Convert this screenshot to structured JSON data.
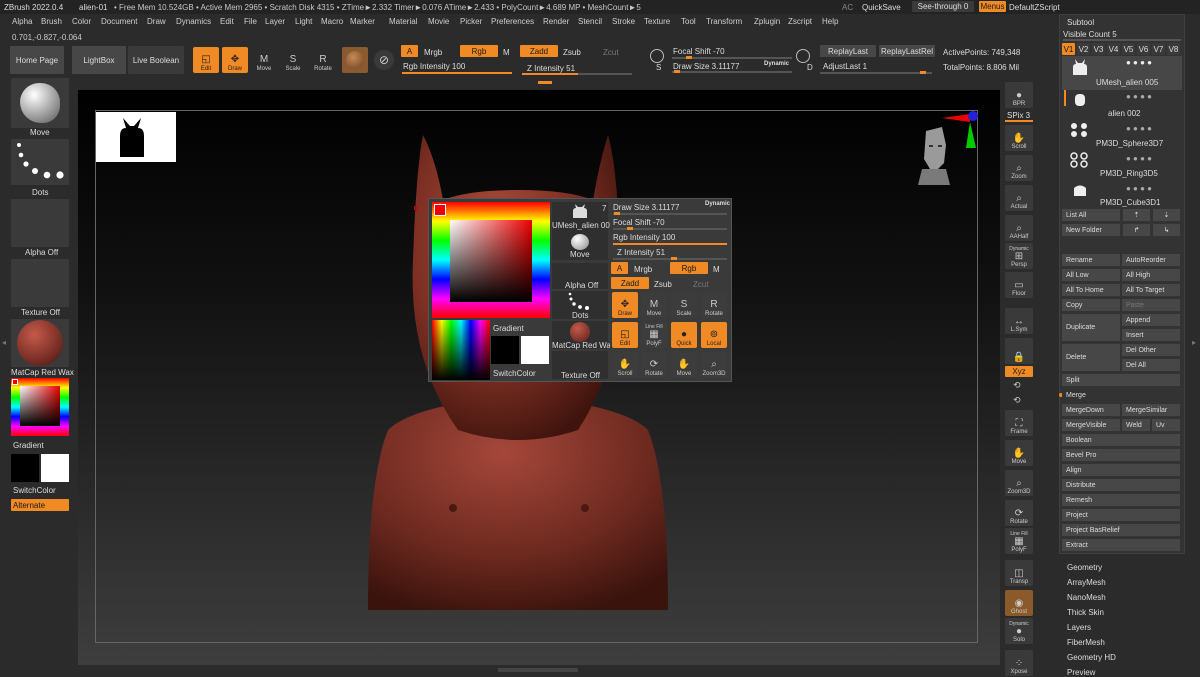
{
  "titlebar": {
    "app": "ZBrush 2022.0.4",
    "doc": "alien-01",
    "stats": "• Free Mem 10.524GB • Active Mem 2965 • Scratch Disk 4315 • ZTime►2.332 Timer►0.076 ATime►2.433 • PolyCount►4.689 MP • MeshCount►5",
    "ac": "AC",
    "quicksave": "QuickSave",
    "seethrough": "See-through  0",
    "menus": "Menus",
    "script": "DefaultZScript"
  },
  "menubar": [
    "Alpha",
    "Brush",
    "Color",
    "Document",
    "Draw",
    "Dynamics",
    "Edit",
    "File",
    "Layer",
    "Light",
    "Macro",
    "Marker",
    "Material",
    "Movie",
    "Picker",
    "Preferences",
    "Render",
    "Stencil",
    "Stroke",
    "Texture",
    "Tool",
    "Transform",
    "Zplugin",
    "Zscript",
    "Help"
  ],
  "coords": "0.701,-0.827,-0.064",
  "toolbar": {
    "home": "Home Page",
    "lightbox": "LightBox",
    "liveboolean": "Live Boolean",
    "edit": "Edit",
    "draw": "Draw",
    "move": "Move",
    "scale": "Scale",
    "rotate": "Rotate",
    "a": "A",
    "mrgb": "Mrgb",
    "rgb": "Rgb",
    "m": "M",
    "zadd": "Zadd",
    "zsub": "Zsub",
    "zcut": "Zcut",
    "rgb_intensity": "Rgb Intensity 100",
    "z_intensity": "Z Intensity 51",
    "focal_shift": "Focal Shift -70",
    "draw_size": "Draw Size 3.11177",
    "dynamic": "Dynamic",
    "replaylast": "ReplayLast",
    "replaylastrel": "ReplayLastRel",
    "adjustlast": "AdjustLast 1",
    "activepoints": "ActivePoints: 749,348",
    "totalpoints": "TotalPoints: 8.806 Mil",
    "s": "S",
    "d": "D"
  },
  "leftshelf": {
    "move": "Move",
    "dots": "Dots",
    "alphaoff": "Alpha Off",
    "textureoff": "Texture Off",
    "matcap": "MatCap Red Wax",
    "gradient": "Gradient",
    "switchcolor": "SwitchColor",
    "alternate": "Alternate"
  },
  "popup": {
    "mesh": "UMesh_alien 005",
    "mesh_count": "7",
    "move": "Move",
    "alphaoff": "Alpha Off",
    "dots": "Dots",
    "matcap": "MatCap Red Wax",
    "textureoff": "Texture Off",
    "gradient": "Gradient",
    "switchcolor": "SwitchColor",
    "draw_size": "Draw Size 3.11177",
    "dynamic": "Dynamic",
    "focal_shift": "Focal Shift -70",
    "rgb_intensity": "Rgb Intensity 100",
    "z_intensity": "Z Intensity 51",
    "a": "A",
    "mrgb": "Mrgb",
    "rgb": "Rgb",
    "m": "M",
    "zadd": "Zadd",
    "zsub": "Zsub",
    "zcut": "Zcut",
    "draw": "Draw",
    "move2": "Move",
    "scale": "Scale",
    "rotate": "Rotate",
    "edit": "Edit",
    "linefill": "Line Fill",
    "polyf": "PolyF",
    "quick": "Quick",
    "local": "Local",
    "scroll": "Scroll",
    "rotate2": "Rotate",
    "move3": "Move",
    "zoom3d": "Zoom3D"
  },
  "rightshelf": {
    "bpr": "BPR",
    "spix": "SPix 3",
    "scroll": "Scroll",
    "zoom": "Zoom",
    "actual": "Actual",
    "aahalf": "AAHalf",
    "dynamic": "Dynamic",
    "persp": "Persp",
    "floor": "Floor",
    "lsym": "L.Sym",
    "xyz": "Xyz",
    "frame": "Frame",
    "move": "Move",
    "zoom3d": "Zoom3D",
    "rotate": "Rotate",
    "linefill": "Line Fill",
    "polyf": "PolyF",
    "transp": "Transp",
    "ghost": "Ghost",
    "dynamic2": "Dynamic",
    "solo": "Solo",
    "xpose": "Xpose"
  },
  "subtool": {
    "title": "Subtool",
    "visiblecount": "Visible Count 5",
    "versions": [
      "V1",
      "V2",
      "V3",
      "V4",
      "V5",
      "V6",
      "V7",
      "V8"
    ],
    "items": [
      "UMesh_alien 005",
      "alien 002",
      "PM3D_Sphere3D7",
      "PM3D_Ring3D5",
      "PM3D_Cube3D1"
    ],
    "listall": "List All",
    "newfolder": "New Folder",
    "rename": "Rename",
    "autoreorder": "AutoReorder",
    "alllow": "All Low",
    "allhigh": "All High",
    "alltohome": "All To Home",
    "alltotarget": "All To Target",
    "copy": "Copy",
    "paste": "Paste",
    "duplicate": "Duplicate",
    "append": "Append",
    "insert": "Insert",
    "delete": "Delete",
    "delother": "Del Other",
    "delall": "Del All",
    "split": "Split",
    "merge": "Merge",
    "mergedown": "MergeDown",
    "mergesimilar": "MergeSimilar",
    "mergevisible": "MergeVisible",
    "weld": "Weld",
    "uv": "Uv",
    "boolean": "Boolean",
    "bevelpro": "Bevel Pro",
    "align": "Align",
    "distribute": "Distribute",
    "remesh": "Remesh",
    "project": "Project",
    "projectbasrelief": "Project BasRelief",
    "extract": "Extract"
  },
  "toolmenus": [
    "Geometry",
    "ArrayMesh",
    "NanoMesh",
    "Thick Skin",
    "Layers",
    "FiberMesh",
    "Geometry HD",
    "Preview"
  ]
}
